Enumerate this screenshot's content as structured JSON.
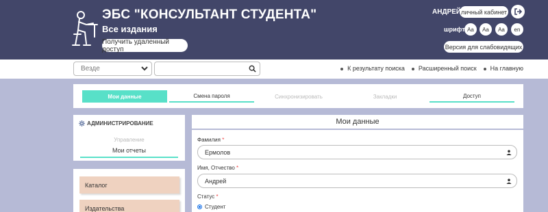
{
  "header": {
    "title": "ЭБС \"КОНСУЛЬТАНТ СТУДЕНТА\"",
    "subtitle": "Все издания",
    "remote_access_label": "Получить удаленный доступ",
    "user_name": "АНДРЕЙ",
    "cabinet_label": "личный кабинет",
    "font_label": "шрифт",
    "font_buttons": [
      "Aa",
      "Aa",
      "Aa",
      "en"
    ],
    "low_vision_label": "Версия для слабовидящих"
  },
  "search": {
    "scope_value": "Везде",
    "placeholder": "",
    "links": [
      "К результату поиска",
      "Расширенный поиск",
      "На главную"
    ]
  },
  "tabs": [
    {
      "label": "Мои данные",
      "state": "active"
    },
    {
      "label": "Смена пароля",
      "state": "normal"
    },
    {
      "label": "Синхронизировать",
      "state": "disabled"
    },
    {
      "label": "Закладки",
      "state": "disabled"
    },
    {
      "label": "Доступ",
      "state": "normal"
    }
  ],
  "sidebar": {
    "admin_title": "АДМИНИСТРИРОВАНИЕ",
    "manage_label": "Управление",
    "reports_label": "Мои отчеты",
    "catalog_items": [
      "Каталог",
      "Издательства"
    ]
  },
  "form": {
    "title": "Мои данные",
    "surname_label": "Фамилия",
    "surname_value": "Ермолов",
    "name_label": "Имя, Отчество",
    "name_value": "Андрей",
    "status_label": "Статус",
    "required_mark": "*",
    "status_option": "Студент"
  },
  "colors": {
    "header_bg": "#424669",
    "page_bg": "#b6bad6",
    "accent": "#58e0c8",
    "catalog_item_bg": "#efd2c0"
  }
}
